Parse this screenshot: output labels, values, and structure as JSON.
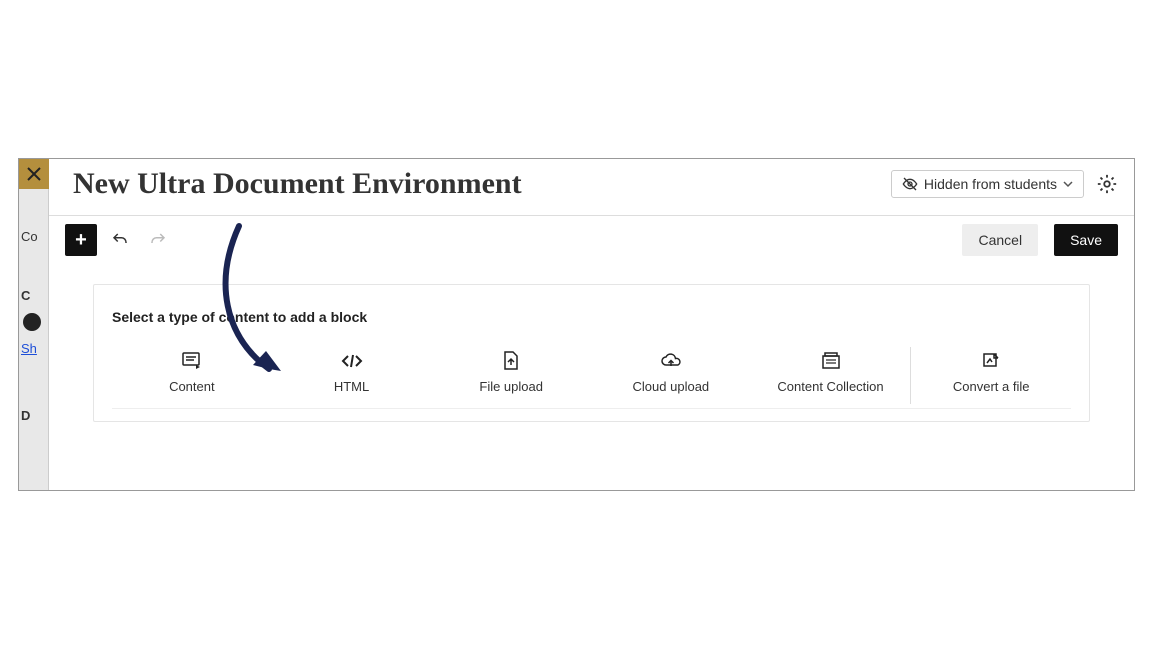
{
  "header": {
    "title": "New Ultra Document Environment",
    "visibility_label": "Hidden from students"
  },
  "toolbar": {
    "add_label": "+",
    "cancel_label": "Cancel",
    "save_label": "Save"
  },
  "block_area": {
    "prompt": "Select a type of content to add a block",
    "options": [
      {
        "label": "Content"
      },
      {
        "label": "HTML"
      },
      {
        "label": "File upload"
      },
      {
        "label": "Cloud upload"
      },
      {
        "label": "Content Collection"
      },
      {
        "label": "Convert a file"
      }
    ]
  },
  "backstrip": {
    "i1": "Co",
    "i2": "C",
    "i3": "Sh",
    "i4": "D"
  }
}
